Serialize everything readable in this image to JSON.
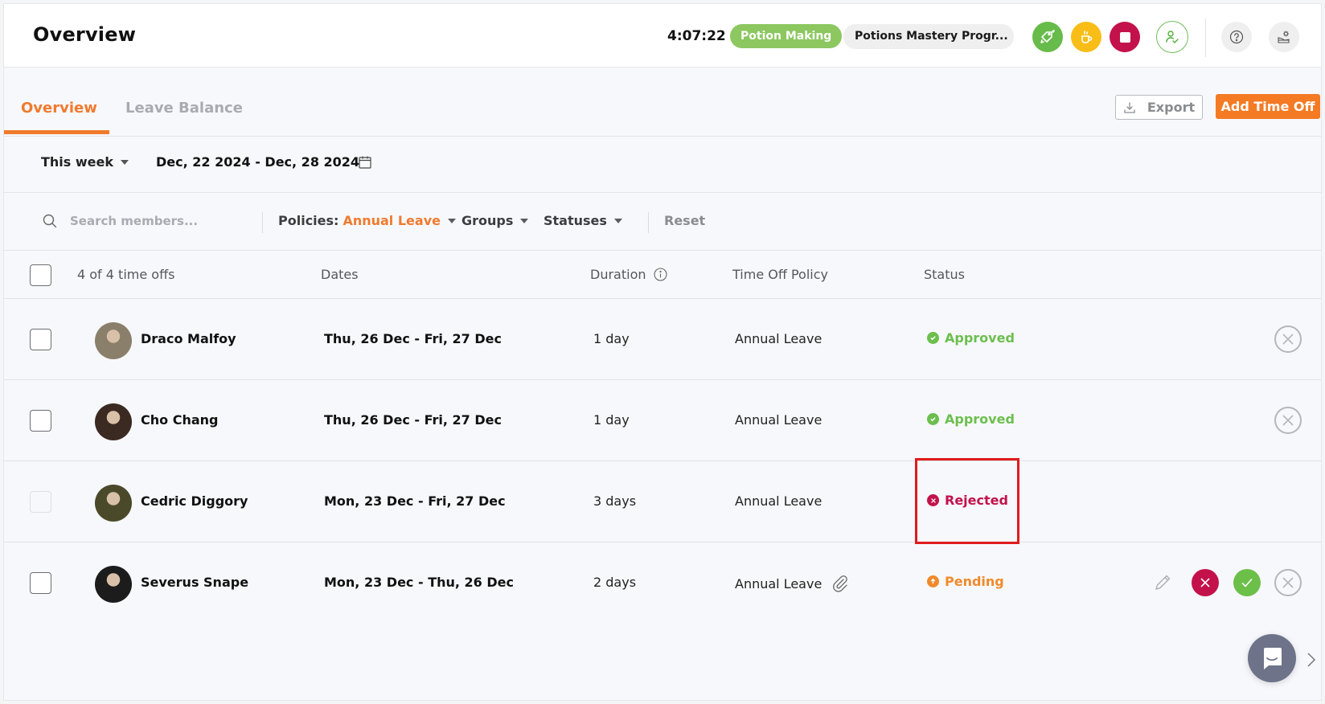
{
  "header": {
    "title": "Overview",
    "timer": "4:07:22",
    "project_label": "Potion Making",
    "task_label": "Potions Mastery Progr...",
    "colors": {
      "project": "#8cc760",
      "switch": "#67bb4a",
      "break": "#f8bd17",
      "stop": "#c3124b"
    }
  },
  "tabs": [
    {
      "label": "Overview",
      "active": true
    },
    {
      "label": "Leave Balance",
      "active": false
    }
  ],
  "actions": {
    "export_label": "Export",
    "add_label": "Add Time Off"
  },
  "date_filter": {
    "range_option": "This week",
    "range_text": "Dec, 22 2024 - Dec, 28 2024"
  },
  "filters": {
    "search_placeholder": "Search members...",
    "policies_label": "Policies",
    "policies_value": "Annual Leave",
    "groups_label": "Groups",
    "statuses_label": "Statuses",
    "reset_label": "Reset"
  },
  "table": {
    "count_label": "4 of 4 time offs",
    "columns": {
      "dates": "Dates",
      "duration": "Duration",
      "policy": "Time Off Policy",
      "status": "Status"
    },
    "rows": [
      {
        "name": "Draco Malfoy",
        "dates": "Thu, 26 Dec - Fri, 27 Dec",
        "duration": "1 day",
        "policy": "Annual Leave",
        "status": "Approved",
        "status_color": "#6cbf4e",
        "attachment": false,
        "checkbox_disabled": false,
        "avatar_color": "#8a7f6a"
      },
      {
        "name": "Cho Chang",
        "dates": "Thu, 26 Dec - Fri, 27 Dec",
        "duration": "1 day",
        "policy": "Annual Leave",
        "status": "Approved",
        "status_color": "#6cbf4e",
        "attachment": false,
        "checkbox_disabled": false,
        "avatar_color": "#3a2a22"
      },
      {
        "name": "Cedric Diggory",
        "dates": "Mon, 23 Dec - Fri, 27 Dec",
        "duration": "3 days",
        "policy": "Annual Leave",
        "status": "Rejected",
        "status_color": "#c3124b",
        "attachment": false,
        "checkbox_disabled": true,
        "avatar_color": "#4a4a2a"
      },
      {
        "name": "Severus Snape",
        "dates": "Mon, 23 Dec - Thu, 26 Dec",
        "duration": "2 days",
        "policy": "Annual Leave",
        "status": "Pending",
        "status_color": "#f08a2c",
        "attachment": true,
        "checkbox_disabled": false,
        "avatar_color": "#1c1c1c"
      }
    ]
  }
}
